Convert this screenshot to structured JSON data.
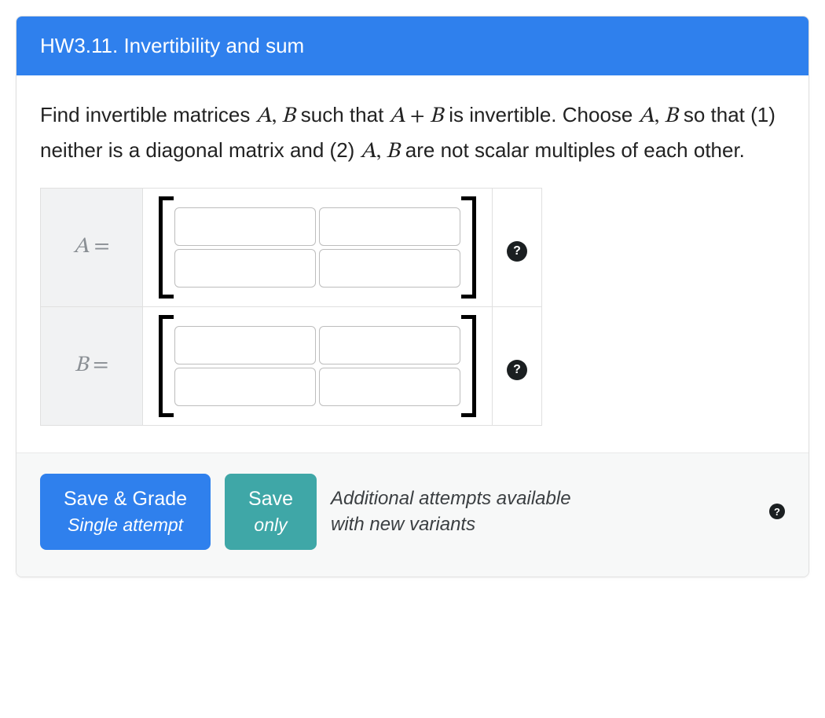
{
  "header": {
    "title": "HW3.11. Invertibility and sum"
  },
  "problem": {
    "line1_prefix": "Find invertible matrices ",
    "sym_A": "A",
    "sym_B": "B",
    "comma_sep": ", ",
    "such_that": " such that ",
    "plus": " + ",
    "line1_suffix": " is invertible.",
    "line2_prefix": "Choose ",
    "line2_mid": " so that (1) neither is a diagonal matrix and (2) ",
    "line3_suffix": " are not scalar multiples of each other."
  },
  "matrices": [
    {
      "label_var": "A",
      "label_eq": "=",
      "help": "?",
      "values": [
        "",
        "",
        "",
        ""
      ]
    },
    {
      "label_var": "B",
      "label_eq": "=",
      "help": "?",
      "values": [
        "",
        "",
        "",
        ""
      ]
    }
  ],
  "footer": {
    "save_grade": {
      "main": "Save & Grade",
      "sub": "Single attempt"
    },
    "save_only": {
      "main": "Save",
      "sub": "only"
    },
    "note_line1": "Additional attempts available",
    "note_line2": "with new variants",
    "help": "?"
  }
}
